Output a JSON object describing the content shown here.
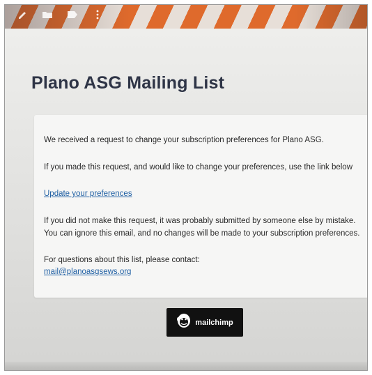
{
  "toolbar": {
    "icons": [
      "pencil-icon",
      "folder-icon",
      "label-icon",
      "more-vertical-icon"
    ]
  },
  "email": {
    "title": "Plano ASG Mailing List",
    "line1": "We received a request to change your subscription preferences for Plano ASG.",
    "line2": "If you made this request, and would like to change your preferences, use the link below",
    "link_label": "Update your preferences",
    "line3": "If you did not make this request, it was probably submitted by someone else by mistake.",
    "line4": "You can ignore this email, and no changes will be made to your subscription preferences.",
    "contact_label": "For questions about this list, please contact:",
    "contact_email": "mail@planoasgsews.org"
  },
  "footer": {
    "brand_text": "mailchimp"
  },
  "colors": {
    "title": "#2e3446",
    "link": "#1f5fa3",
    "banner_orange": "#df6a2c",
    "logo_bg": "#111111"
  }
}
